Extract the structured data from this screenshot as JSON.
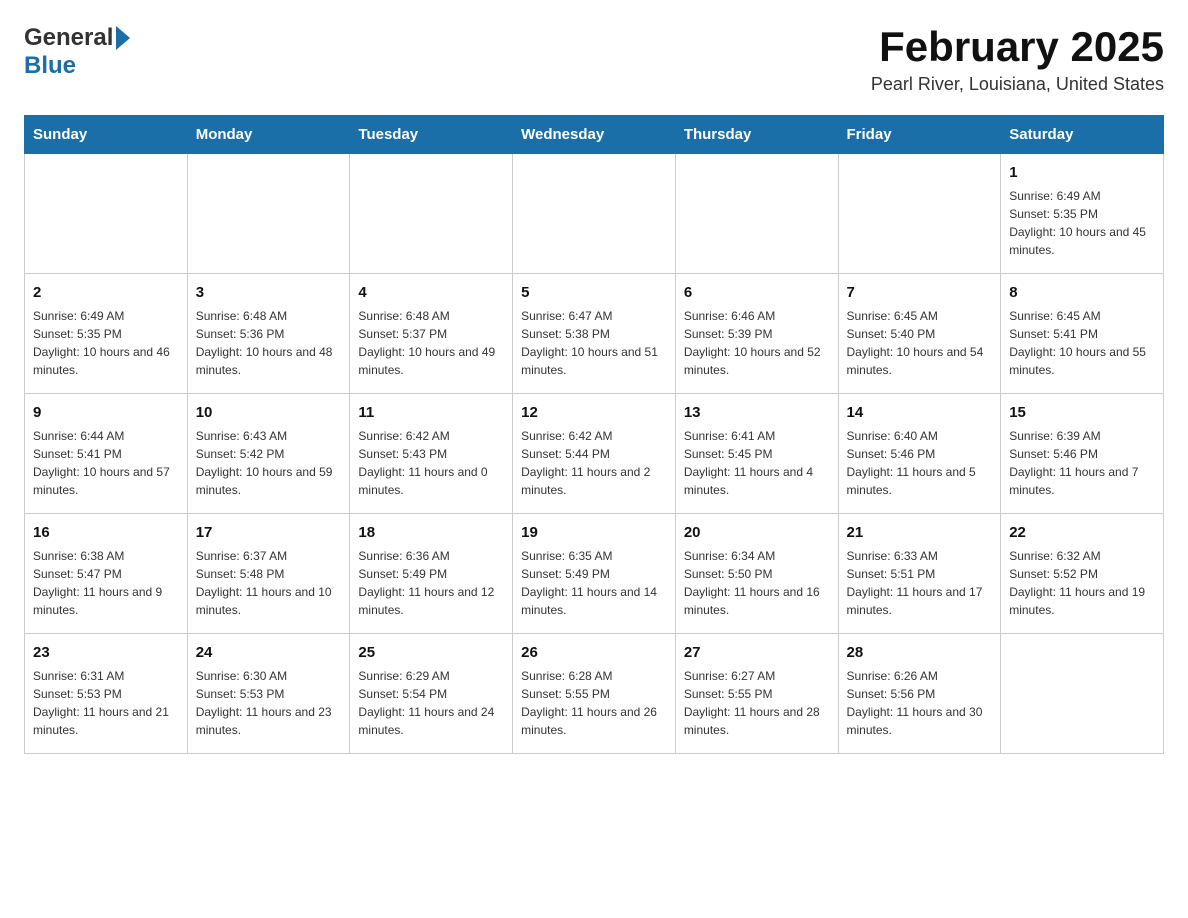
{
  "header": {
    "logo": {
      "general": "General",
      "blue": "Blue",
      "arrow": "▶"
    },
    "title": "February 2025",
    "location": "Pearl River, Louisiana, United States"
  },
  "calendar": {
    "days": [
      "Sunday",
      "Monday",
      "Tuesday",
      "Wednesday",
      "Thursday",
      "Friday",
      "Saturday"
    ],
    "weeks": [
      [
        {
          "day": "",
          "info": ""
        },
        {
          "day": "",
          "info": ""
        },
        {
          "day": "",
          "info": ""
        },
        {
          "day": "",
          "info": ""
        },
        {
          "day": "",
          "info": ""
        },
        {
          "day": "",
          "info": ""
        },
        {
          "day": "1",
          "info": "Sunrise: 6:49 AM\nSunset: 5:35 PM\nDaylight: 10 hours and 45 minutes."
        }
      ],
      [
        {
          "day": "2",
          "info": "Sunrise: 6:49 AM\nSunset: 5:35 PM\nDaylight: 10 hours and 46 minutes."
        },
        {
          "day": "3",
          "info": "Sunrise: 6:48 AM\nSunset: 5:36 PM\nDaylight: 10 hours and 48 minutes."
        },
        {
          "day": "4",
          "info": "Sunrise: 6:48 AM\nSunset: 5:37 PM\nDaylight: 10 hours and 49 minutes."
        },
        {
          "day": "5",
          "info": "Sunrise: 6:47 AM\nSunset: 5:38 PM\nDaylight: 10 hours and 51 minutes."
        },
        {
          "day": "6",
          "info": "Sunrise: 6:46 AM\nSunset: 5:39 PM\nDaylight: 10 hours and 52 minutes."
        },
        {
          "day": "7",
          "info": "Sunrise: 6:45 AM\nSunset: 5:40 PM\nDaylight: 10 hours and 54 minutes."
        },
        {
          "day": "8",
          "info": "Sunrise: 6:45 AM\nSunset: 5:41 PM\nDaylight: 10 hours and 55 minutes."
        }
      ],
      [
        {
          "day": "9",
          "info": "Sunrise: 6:44 AM\nSunset: 5:41 PM\nDaylight: 10 hours and 57 minutes."
        },
        {
          "day": "10",
          "info": "Sunrise: 6:43 AM\nSunset: 5:42 PM\nDaylight: 10 hours and 59 minutes."
        },
        {
          "day": "11",
          "info": "Sunrise: 6:42 AM\nSunset: 5:43 PM\nDaylight: 11 hours and 0 minutes."
        },
        {
          "day": "12",
          "info": "Sunrise: 6:42 AM\nSunset: 5:44 PM\nDaylight: 11 hours and 2 minutes."
        },
        {
          "day": "13",
          "info": "Sunrise: 6:41 AM\nSunset: 5:45 PM\nDaylight: 11 hours and 4 minutes."
        },
        {
          "day": "14",
          "info": "Sunrise: 6:40 AM\nSunset: 5:46 PM\nDaylight: 11 hours and 5 minutes."
        },
        {
          "day": "15",
          "info": "Sunrise: 6:39 AM\nSunset: 5:46 PM\nDaylight: 11 hours and 7 minutes."
        }
      ],
      [
        {
          "day": "16",
          "info": "Sunrise: 6:38 AM\nSunset: 5:47 PM\nDaylight: 11 hours and 9 minutes."
        },
        {
          "day": "17",
          "info": "Sunrise: 6:37 AM\nSunset: 5:48 PM\nDaylight: 11 hours and 10 minutes."
        },
        {
          "day": "18",
          "info": "Sunrise: 6:36 AM\nSunset: 5:49 PM\nDaylight: 11 hours and 12 minutes."
        },
        {
          "day": "19",
          "info": "Sunrise: 6:35 AM\nSunset: 5:49 PM\nDaylight: 11 hours and 14 minutes."
        },
        {
          "day": "20",
          "info": "Sunrise: 6:34 AM\nSunset: 5:50 PM\nDaylight: 11 hours and 16 minutes."
        },
        {
          "day": "21",
          "info": "Sunrise: 6:33 AM\nSunset: 5:51 PM\nDaylight: 11 hours and 17 minutes."
        },
        {
          "day": "22",
          "info": "Sunrise: 6:32 AM\nSunset: 5:52 PM\nDaylight: 11 hours and 19 minutes."
        }
      ],
      [
        {
          "day": "23",
          "info": "Sunrise: 6:31 AM\nSunset: 5:53 PM\nDaylight: 11 hours and 21 minutes."
        },
        {
          "day": "24",
          "info": "Sunrise: 6:30 AM\nSunset: 5:53 PM\nDaylight: 11 hours and 23 minutes."
        },
        {
          "day": "25",
          "info": "Sunrise: 6:29 AM\nSunset: 5:54 PM\nDaylight: 11 hours and 24 minutes."
        },
        {
          "day": "26",
          "info": "Sunrise: 6:28 AM\nSunset: 5:55 PM\nDaylight: 11 hours and 26 minutes."
        },
        {
          "day": "27",
          "info": "Sunrise: 6:27 AM\nSunset: 5:55 PM\nDaylight: 11 hours and 28 minutes."
        },
        {
          "day": "28",
          "info": "Sunrise: 6:26 AM\nSunset: 5:56 PM\nDaylight: 11 hours and 30 minutes."
        },
        {
          "day": "",
          "info": ""
        }
      ]
    ]
  }
}
